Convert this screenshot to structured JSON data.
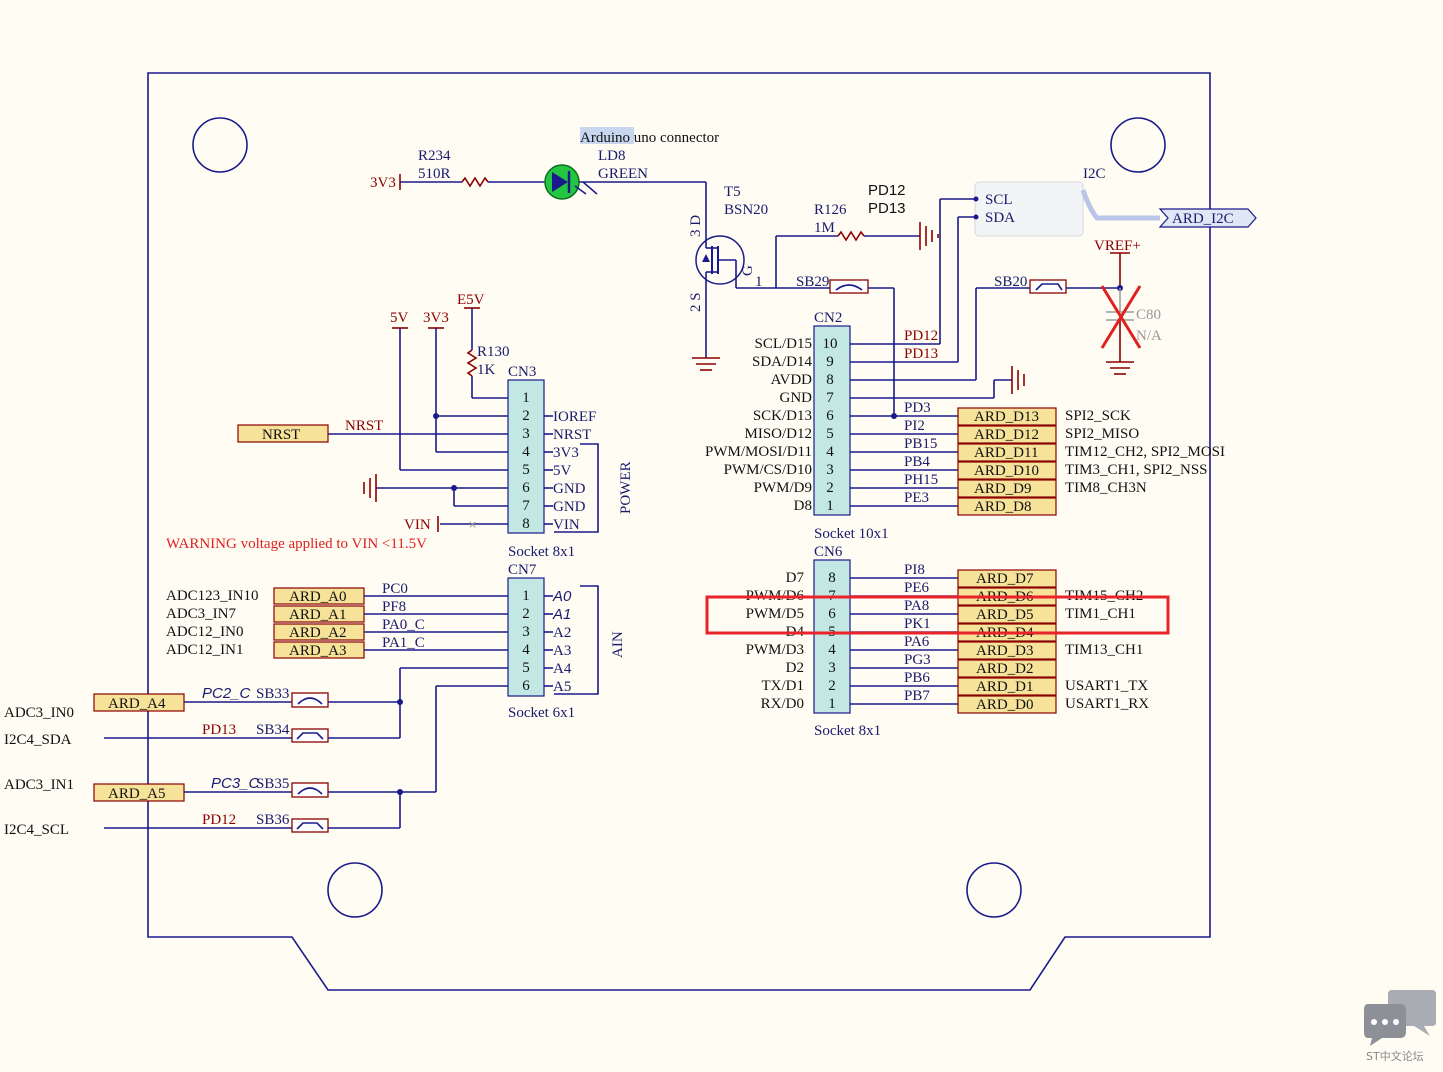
{
  "board": {
    "arduino_label_highlight": "Arduino",
    "arduino_label_rest": " uno connector"
  },
  "led": {
    "ref": "R234",
    "value": "510R",
    "supply": "3V3",
    "ld": "LD8",
    "color": "GREEN"
  },
  "mosfet": {
    "ref": "T5",
    "part": "BSN20",
    "pin_d": "3 D",
    "pin_s": "2 S",
    "pin_g": "1",
    "g_label": "G"
  },
  "r126": {
    "ref": "R126",
    "value": "1M"
  },
  "i2c": {
    "pd12": "PD12",
    "pd13": "PD13",
    "scl": "SCL",
    "sda": "SDA",
    "title": "I2C",
    "port": "ARD_I2C"
  },
  "vref": {
    "label": "VREF+",
    "sb20": "SB20",
    "sb29": "SB29",
    "c80": "C80",
    "c80_val": "N/A"
  },
  "power": {
    "supplies": [
      "5V",
      "3V3",
      "E5V"
    ],
    "r130": "R130",
    "r130_val": "1K",
    "ref": "CN3",
    "pins": [
      "1",
      "2",
      "3",
      "4",
      "5",
      "6",
      "7",
      "8"
    ],
    "names": [
      "IOREF",
      "NRST",
      "3V3",
      "5V",
      "GND",
      "GND",
      "VIN"
    ],
    "title": "POWER",
    "socket": "Socket 8x1",
    "nrst_port": "NRST",
    "nrst_wire": "NRST",
    "vin_label": "VIN",
    "warning": "WARNING voltage applied to VIN <11.5V"
  },
  "cn7": {
    "ref": "CN7",
    "pins": [
      "1",
      "2",
      "3",
      "4",
      "5",
      "6"
    ],
    "right": [
      "A0",
      "A1",
      "A2",
      "A3",
      "A4",
      "A5"
    ],
    "title": "AIN",
    "socket": "Socket 6x1",
    "adc": [
      "ADC123_IN10",
      "ADC3_IN7",
      "ADC12_IN0",
      "ADC12_IN1"
    ],
    "ports": [
      "ARD_A0",
      "ARD_A1",
      "ARD_A2",
      "ARD_A3"
    ],
    "nets": [
      "PC0",
      "PF8",
      "PA0_C",
      "PA1_C"
    ]
  },
  "lower_left": {
    "a4_port": "ARD_A4",
    "a5_port": "ARD_A5",
    "pc2": "PC2_C",
    "pc3": "PC3_C",
    "sb33": "SB33",
    "sb34": "SB34",
    "sb35": "SB35",
    "sb36": "SB36",
    "pd13": "PD13",
    "pd12": "PD12",
    "adc3_in0": "ADC3_IN0",
    "i2c4_sda": "I2C4_SDA",
    "adc3_in1": "ADC3_IN1",
    "i2c4_scl": "I2C4_SCL"
  },
  "cn2": {
    "ref": "CN2",
    "pins": [
      "10",
      "9",
      "8",
      "7",
      "6",
      "5",
      "4",
      "3",
      "2",
      "1"
    ],
    "left": [
      "SCL/D15",
      "SDA/D14",
      "AVDD",
      "GND",
      "SCK/D13",
      "MISO/D12",
      "PWM/MOSI/D11",
      "PWM/CS/D10",
      "PWM/D9",
      "D8"
    ],
    "nets": [
      "PD12",
      "PD13",
      "PD3",
      "PI2",
      "PB15",
      "PB4",
      "PH15",
      "PE3"
    ],
    "ports": [
      "ARD_D13",
      "ARD_D12",
      "ARD_D11",
      "ARD_D10",
      "ARD_D9",
      "ARD_D8"
    ],
    "funcs": [
      "SPI2_SCK",
      "SPI2_MISO",
      "TIM12_CH2, SPI2_MOSI",
      "TIM3_CH1, SPI2_NSS",
      "TIM8_CH3N"
    ],
    "socket": "Socket 10x1"
  },
  "cn6": {
    "ref": "CN6",
    "pins": [
      "8",
      "7",
      "6",
      "5",
      "4",
      "3",
      "2",
      "1"
    ],
    "left": [
      "D7",
      "PWM/D6",
      "PWM/D5",
      "D4",
      "PWM/D3",
      "D2",
      "TX/D1",
      "RX/D0"
    ],
    "nets": [
      "PI8",
      "PE6",
      "PA8",
      "PK1",
      "PA6",
      "PG3",
      "PB6",
      "PB7"
    ],
    "ports": [
      "ARD_D7",
      "ARD_D6",
      "ARD_D5",
      "ARD_D4",
      "ARD_D3",
      "ARD_D2",
      "ARD_D1",
      "ARD_D0"
    ],
    "funcs": [
      "TIM15_CH2",
      "TIM1_CH1",
      "TIM13_CH1",
      "USART1_TX",
      "USART1_RX"
    ],
    "socket": "Socket 8x1"
  },
  "watermark": "ST中文论坛",
  "colors": {
    "highlight": "#e8232a",
    "wire": "#1a1a8c",
    "power": "#8b0000",
    "connector": "#c3e8e4",
    "port": "#f7e29a"
  }
}
